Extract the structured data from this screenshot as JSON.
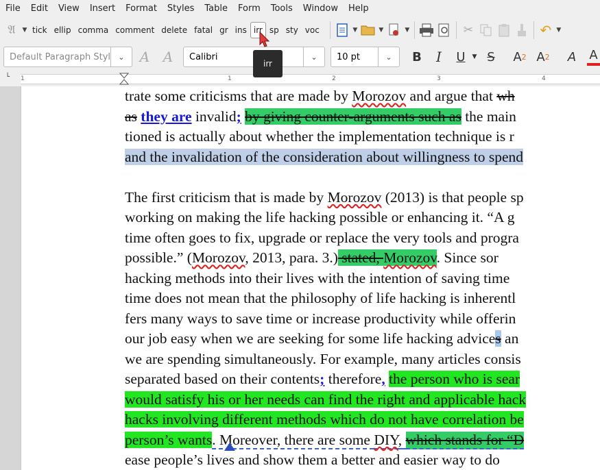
{
  "menu": [
    "File",
    "Edit",
    "View",
    "Insert",
    "Format",
    "Styles",
    "Table",
    "Form",
    "Tools",
    "Window",
    "Help"
  ],
  "toolbar": {
    "macro_buttons": [
      "tick",
      "ellip",
      "comma",
      "comment",
      "delete",
      "fatal",
      "gr",
      "ins",
      "irr",
      "sp",
      "sty",
      "voc"
    ],
    "active_button": "irr",
    "tooltip": "irr"
  },
  "format": {
    "paragraph_style": "Default Paragraph Styl",
    "font_name": "Calibri",
    "font_size": "10 pt",
    "bold": "B",
    "italic": "I",
    "underline": "U",
    "strike": "S",
    "superscript": "A",
    "superscript_mark": "2",
    "subscript": "A",
    "subscript_mark": "2",
    "char_style": "A",
    "font_color": "A"
  },
  "ruler": {
    "labels": [
      "1",
      "1",
      "2",
      "3",
      "4"
    ]
  },
  "document": {
    "p1": {
      "l1a": "trate some criticisms that are made by ",
      "l1b": "Morozov",
      "l1c": " and argue that ",
      "l1d": "wh",
      "l2a": "as",
      "l2b": " ",
      "l2c": "they are",
      "l2d": " invalid",
      "l2e": ";",
      "l2f": " ",
      "l2g": "by giving counter-arguments such as",
      "l2h": " the main",
      "l3": "tioned is actually about whether the implementation technique is r",
      "l4": "and the invalidation of the consideration about willingness to spend"
    },
    "p2": {
      "l1a": "The first criticism that is made by ",
      "l1b": "Morozov",
      "l1c": " (2013) is that people sp",
      "l2": "working on making the life hacking possible or enhancing it. “A g",
      "l3a": "time often goes to fix, upgrade or replace the very tools and progra",
      "l4a": "possible.” (",
      "l4b": "Morozov",
      "l4c": ", 2013, para. 3.)",
      "l4d": " stated, ",
      "l4e": "Morozov",
      "l4f": ". Since sor",
      "l5": "hacking methods into their lives with the intention of saving time",
      "l6": "time does not mean that the philosophy of life hacking is inherentl",
      "l7": "fers many ways to save time or increase productivity while offerin",
      "l8a": "our job easy when we are seeking for some life hacking advice",
      "l8b": "s",
      "l8c": " an",
      "l9": "we are spending simultaneously. For example, many articles consis",
      "l10a": "separated based on their contents",
      "l10b": ";",
      "l10c": " therefore",
      "l10d": ",",
      "l10e": " ",
      "l10f": "the person who is sear",
      "l11": "would satisfy his or her needs can find the right and applicable hack",
      "l12": "hacks involving different methods which do not have correlation be",
      "l13a": "person’s wants",
      "l13b": ". Moreover, there are some ",
      "l13c": "DIY",
      "l13d": ", ",
      "l13e": "which stands for “D",
      "l14": "ease people’s lives and show them a better and easier way to do"
    }
  }
}
